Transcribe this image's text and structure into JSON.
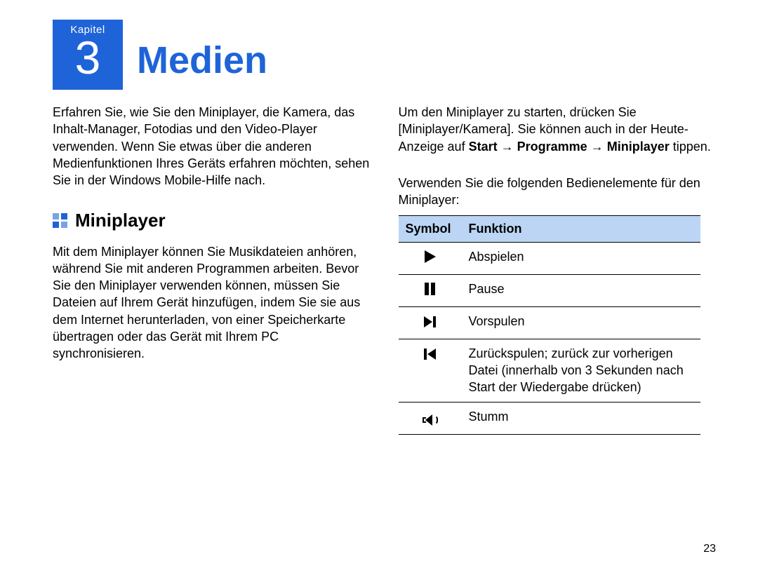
{
  "chapter": {
    "label": "Kapitel",
    "number": "3",
    "title": "Medien"
  },
  "left": {
    "intro": "Erfahren Sie, wie Sie den Miniplayer, die Kamera, das Inhalt-Manager, Fotodias und den Video-Player verwenden. Wenn Sie etwas über die anderen Medienfunktionen Ihres Geräts erfahren möchten, sehen Sie in der Windows Mobile-Hilfe nach.",
    "section_title": "Miniplayer",
    "mini_desc": "Mit dem Miniplayer können Sie Musikdateien anhören, während Sie mit anderen Programmen arbeiten. Bevor Sie den Miniplayer verwenden können, müssen Sie Dateien auf Ihrem Gerät hinzufügen, indem Sie sie aus dem Internet herunterladen, von einer Speicherkarte übertragen oder das Gerät mit Ihrem PC synchronisieren."
  },
  "right": {
    "start_pre": "Um den Miniplayer zu starten, drücken Sie [Miniplayer/Kamera]. Sie können auch in der Heute-Anzeige auf ",
    "start_bold": "Start",
    "arrow": "→",
    "programme_bold": "Programme",
    "miniplayer_bold": "Miniplayer",
    "tippen": " tippen.",
    "use_text": "Verwenden Sie die folgenden Bedienelemente für den Miniplayer:",
    "headers": {
      "symbol": "Symbol",
      "funktion": "Funktion"
    },
    "rows": {
      "play": "Abspielen",
      "pause": "Pause",
      "fwd": "Vorspulen",
      "back": "Zurückspulen; zurück zur vorherigen Datei (innerhalb von 3 Sekunden nach Start der Wiedergabe drücken)",
      "mute": "Stumm"
    }
  },
  "page_number": "23"
}
